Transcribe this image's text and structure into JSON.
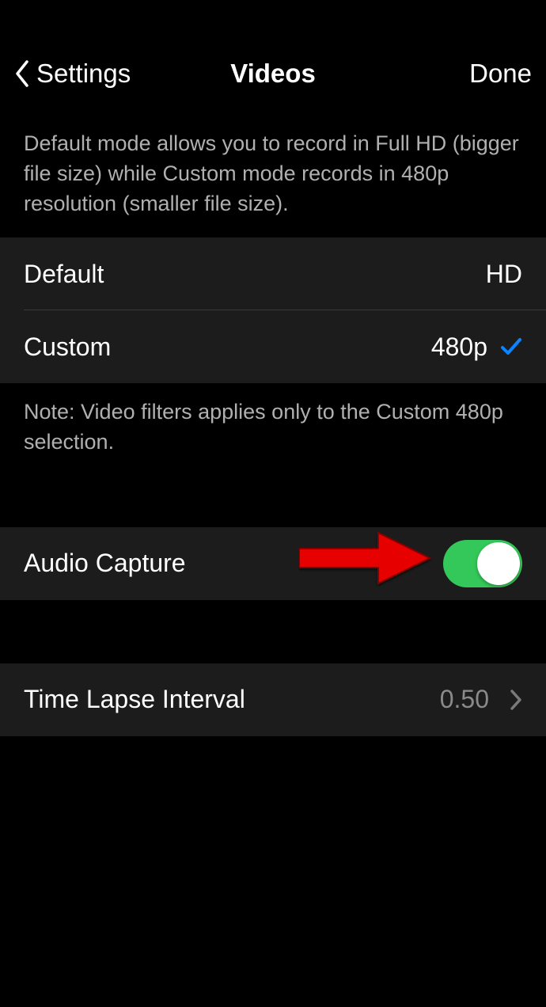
{
  "nav": {
    "back_label": "Settings",
    "title": "Videos",
    "done_label": "Done"
  },
  "mode_section": {
    "header_text": "Default mode allows you to record in Full HD (bigger file size) while Custom mode records in 480p resolution (smaller file size).",
    "default_label": "Default",
    "default_value": "HD",
    "custom_label": "Custom",
    "custom_value": "480p",
    "footer_text": "Note: Video filters applies only to the Custom 480p selection."
  },
  "audio_section": {
    "label": "Audio Capture",
    "toggle_on": true
  },
  "timelapse_section": {
    "label": "Time Lapse Interval",
    "value": "0.50"
  }
}
